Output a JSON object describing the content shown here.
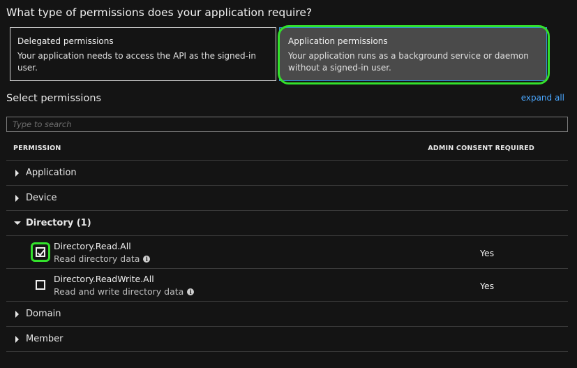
{
  "question": "What type of permissions does your application require?",
  "permission_types": [
    {
      "title": "Delegated permissions",
      "description": "Your application needs to access the API as the signed-in user."
    },
    {
      "title": "Application permissions",
      "description": "Your application runs as a background service or daemon without a signed-in user."
    }
  ],
  "selected_permission_type": "Application permissions",
  "select_permissions_title": "Select permissions",
  "expand_all_label": "expand all",
  "search": {
    "placeholder": "Type to search",
    "value": ""
  },
  "table": {
    "headers": {
      "permission": "PERMISSION",
      "admin_consent": "ADMIN CONSENT REQUIRED"
    },
    "groups": [
      {
        "label": "Application",
        "expanded": false
      },
      {
        "label": "Device",
        "expanded": false
      },
      {
        "label": "Directory (1)",
        "expanded": true
      },
      {
        "label": "Domain",
        "expanded": false
      },
      {
        "label": "Member",
        "expanded": false
      }
    ],
    "directory_permissions": [
      {
        "name": "Directory.Read.All",
        "description": "Read directory data",
        "admin_consent": "Yes",
        "checked": true
      },
      {
        "name": "Directory.ReadWrite.All",
        "description": "Read and write directory data",
        "admin_consent": "Yes",
        "checked": false
      }
    ]
  },
  "colors": {
    "highlight": "#33e12c",
    "accent_link": "#4aa7ff",
    "selected_card_bg": "#4a4a4a",
    "selected_card_border": "#2f8fd6"
  },
  "icons": {
    "collapsed": "caret-right-icon",
    "expanded": "caret-down-icon",
    "info": "info-icon",
    "check": "checkbox-check-icon"
  }
}
